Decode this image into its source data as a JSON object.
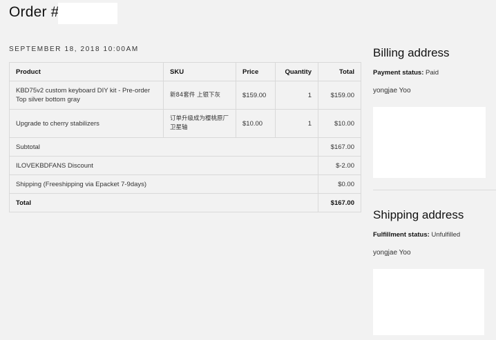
{
  "order": {
    "title": "Order #",
    "date": "SEPTEMBER 18, 2018 10:00AM"
  },
  "table": {
    "headers": {
      "product": "Product",
      "sku": "SKU",
      "price": "Price",
      "quantity": "Quantity",
      "total": "Total"
    },
    "rows": [
      {
        "product": "KBD75v2 custom keyboard DIY kit - Pre-order Top silver bottom gray",
        "sku": "新84套件 上银下灰",
        "price": "$159.00",
        "quantity": "1",
        "total": "$159.00"
      },
      {
        "product": "Upgrade to cherry stabilizers",
        "sku": "订单升级成为樱桃原厂卫星轴",
        "price": "$10.00",
        "quantity": "1",
        "total": "$10.00"
      }
    ],
    "summary": [
      {
        "label": "Subtotal",
        "value": "$167.00"
      },
      {
        "label": "ILOVEKBDFANS Discount",
        "value": "$-2.00"
      },
      {
        "label": "Shipping (Freeshipping via Epacket 7-9days)",
        "value": "$0.00"
      },
      {
        "label": "Total",
        "value": "$167.00"
      }
    ]
  },
  "billing": {
    "heading": "Billing address",
    "status_label": "Payment status:",
    "status_value": "Paid",
    "name": "yongjae Yoo"
  },
  "shipping": {
    "heading": "Shipping address",
    "status_label": "Fulfillment status:",
    "status_value": "Unfulfilled",
    "name": "yongjae Yoo"
  }
}
